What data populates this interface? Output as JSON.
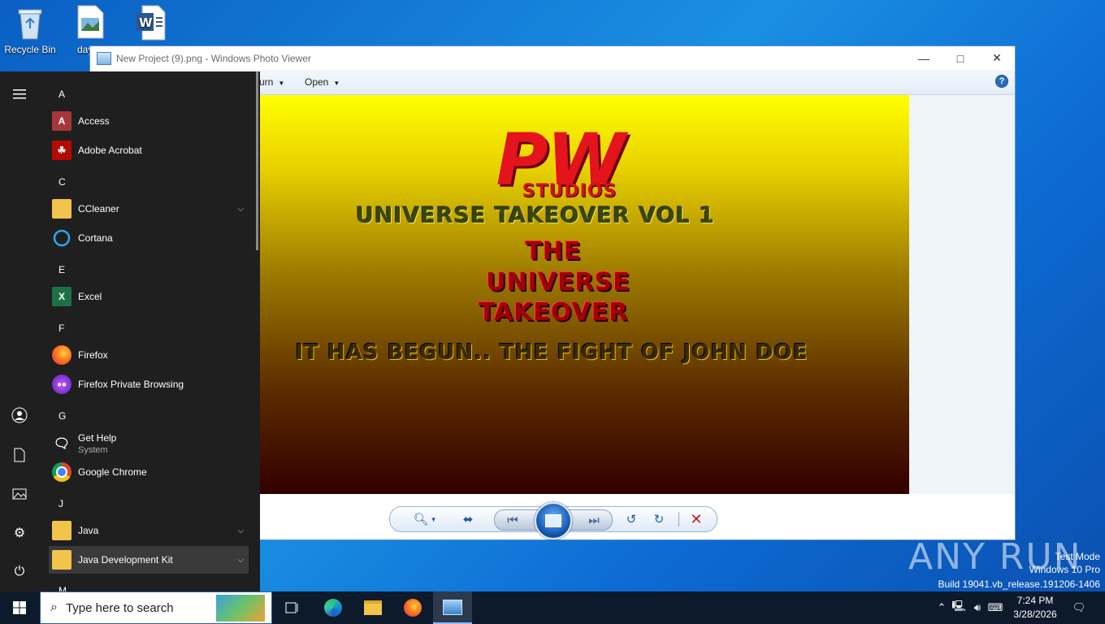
{
  "desktop": {
    "icons": [
      {
        "label": "Recycle Bin",
        "icon": "recycle-bin-icon"
      },
      {
        "label": "daysd",
        "icon": "image-file-icon"
      },
      {
        "label": "",
        "icon": "word-document-icon"
      }
    ]
  },
  "photo_viewer": {
    "title": "New Project (9).png - Windows Photo Viewer",
    "toolbar": {
      "burn_label": "urn",
      "open_label": "Open"
    },
    "poster": {
      "logo": "PW",
      "studios": "STUDIOS",
      "headline": "UNIVERSE TAKEOVER VOL 1",
      "title_lines": [
        "THE",
        "UNIVERSE",
        "TAKEOVER"
      ],
      "tagline": "IT HAS BEGUN.. THE FIGHT OF JOHN DOE"
    }
  },
  "start_menu": {
    "sections": [
      {
        "letter": "A",
        "apps": [
          {
            "label": "Access"
          },
          {
            "label": "Adobe Acrobat"
          }
        ]
      },
      {
        "letter": "C",
        "apps": [
          {
            "label": "CCleaner",
            "expandable": true
          },
          {
            "label": "Cortana"
          }
        ]
      },
      {
        "letter": "E",
        "apps": [
          {
            "label": "Excel"
          }
        ]
      },
      {
        "letter": "F",
        "apps": [
          {
            "label": "Firefox"
          },
          {
            "label": "Firefox Private Browsing"
          }
        ]
      },
      {
        "letter": "G",
        "apps": [
          {
            "label": "Get Help",
            "sub": "System"
          },
          {
            "label": "Google Chrome"
          }
        ]
      },
      {
        "letter": "J",
        "apps": [
          {
            "label": "Java",
            "expandable": true
          },
          {
            "label": "Java Development Kit",
            "expandable": true
          }
        ]
      },
      {
        "letter": "M",
        "apps": []
      }
    ]
  },
  "taskbar": {
    "search_placeholder": "Type here to search",
    "time": "7:24 PM",
    "date": "3/28/2026"
  },
  "watermark": {
    "line1": "Test Mode",
    "line2": "Windows 10 Pro",
    "line3": "Build 19041.vb_release.191206-1406",
    "brand": "ANY RUN"
  },
  "colors": {
    "taskbar": "#0d1a2b",
    "start_menu": "#1f1f1f",
    "accent": "#0078d7"
  }
}
